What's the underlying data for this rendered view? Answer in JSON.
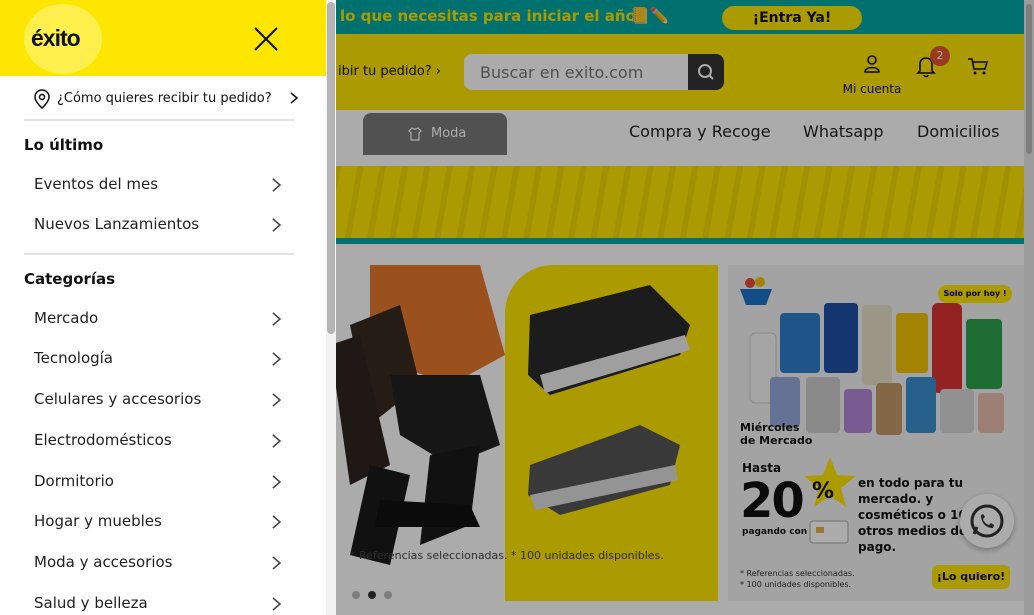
{
  "promo_bar": {
    "text": "lo que necesitas para iniciar el año",
    "cta": "¡Entra Ya!"
  },
  "header": {
    "delivery_text": "ibir tu pedido?",
    "search_placeholder": "Buscar en exito.com",
    "account_label": "Mi cuenta",
    "notifications_count": "2"
  },
  "nav": {
    "active_tab": "Moda",
    "links": [
      "Compra y Recoge",
      "Whatsapp",
      "Domicilios"
    ]
  },
  "banner_fashion": {
    "note": "* Referencias seleccionadas. * 100 unidades disponibles."
  },
  "banner_market": {
    "badge": "Solo por hoy !",
    "title_line1": "Miércoles",
    "title_line2": "de Mercado",
    "hasta": "Hasta",
    "percent": "20",
    "percent_sign": "%",
    "pagando_con": "pagando con",
    "description": "en todo para tu mercado. y cosméticos o 10% otros medios de pago.",
    "fine_print_1": "* Referencias seleccionadas.",
    "fine_print_2": "* 100 unidades disponibles.",
    "cta": "¡Lo quiero!"
  },
  "drawer": {
    "logo_text": "éxito",
    "delivery_prompt": "¿Cómo quieres recibir tu pedido?",
    "sections": [
      {
        "title": "Lo último",
        "items": [
          "Eventos del mes",
          "Nuevos Lanzamientos"
        ]
      },
      {
        "title": "Categorías",
        "items": [
          "Mercado",
          "Tecnología",
          "Celulares y accesorios",
          "Electrodomésticos",
          "Dormitorio",
          "Hogar y muebles",
          "Moda y accesorios",
          "Salud y belleza"
        ]
      }
    ]
  },
  "colors": {
    "brand_yellow": "#ffe600",
    "teal": "#00a9a6",
    "overlay": "rgba(0,0,0,0.33)"
  }
}
